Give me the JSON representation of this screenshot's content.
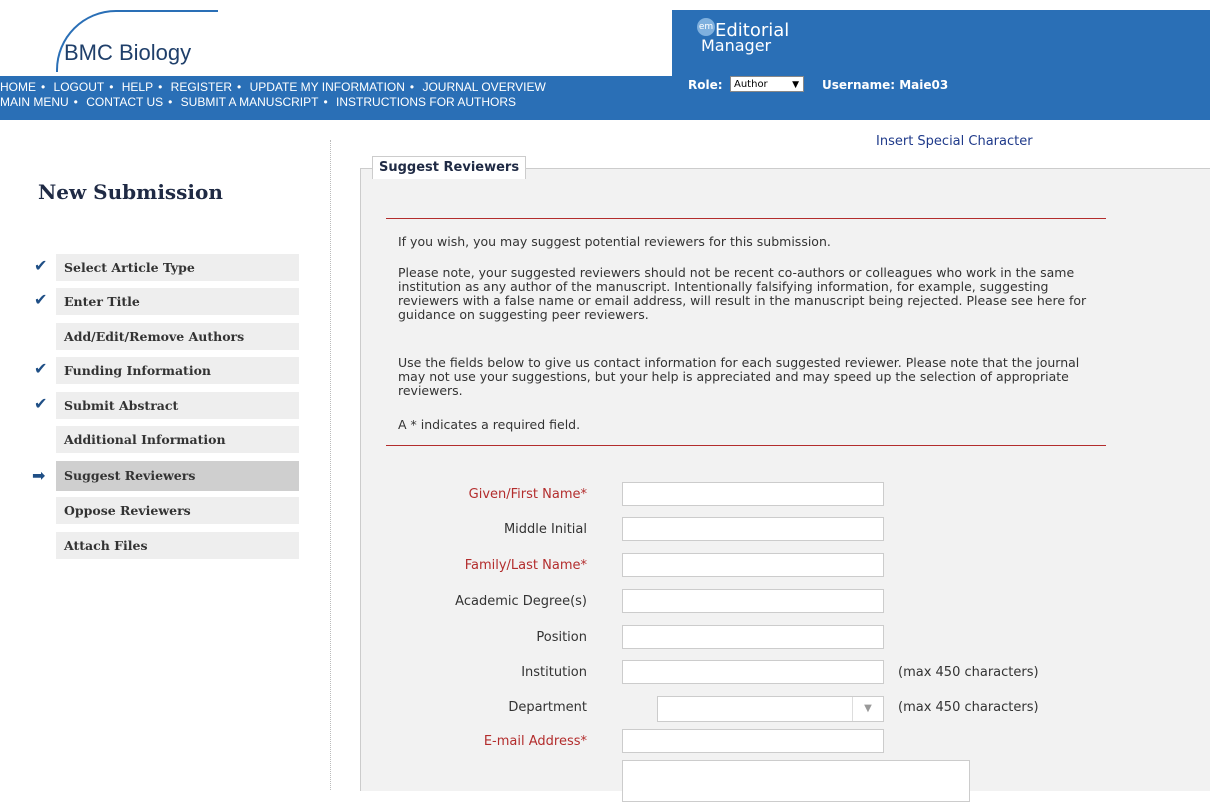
{
  "header": {
    "logo_text": "BMC Biology",
    "nav_row1": [
      "HOME",
      "LOGOUT",
      "HELP",
      "REGISTER",
      "UPDATE MY INFORMATION",
      "JOURNAL OVERVIEW"
    ],
    "nav_row2": [
      "MAIN MENU",
      "CONTACT US",
      "SUBMIT A MANUSCRIPT",
      "INSTRUCTIONS FOR AUTHORS"
    ],
    "em_badge": "em",
    "em_line1": "Editorial",
    "em_line2": "Manager",
    "role_label": "Role:",
    "role_value": "Author",
    "username_label": "Username: Maie03"
  },
  "sidebar": {
    "title": "New Submission",
    "steps": [
      {
        "label": "Select Article Type",
        "status": "done"
      },
      {
        "label": "Enter Title",
        "status": "done"
      },
      {
        "label": "Add/Edit/Remove Authors",
        "status": "none"
      },
      {
        "label": "Funding Information",
        "status": "done"
      },
      {
        "label": "Submit Abstract",
        "status": "done"
      },
      {
        "label": "Additional Information",
        "status": "none"
      },
      {
        "label": "Suggest Reviewers",
        "status": "current"
      },
      {
        "label": "Oppose Reviewers",
        "status": "none"
      },
      {
        "label": "Attach Files",
        "status": "none"
      }
    ]
  },
  "main": {
    "insert_special": "Insert Special Character",
    "panel_title": "Suggest Reviewers",
    "para1": "If you wish, you may suggest potential reviewers for this submission.",
    "para2": "Please note, your suggested reviewers should not be recent co-authors or colleagues who work in the same institution as any author of the manuscript. Intentionally falsifying information, for example, suggesting reviewers with a false name or email address, will result in the manuscript being rejected. Please see here for guidance on suggesting peer reviewers.",
    "para3": "Use the fields below to give us contact information for each suggested reviewer. Please note that the journal may not use your suggestions, but your help is appreciated and may speed up the selection of appropriate reviewers.",
    "para4": "A * indicates a required field.",
    "fields": {
      "given_name": "Given/First Name*",
      "middle_initial": "Middle Initial",
      "family_name": "Family/Last Name*",
      "academic_degree": "Academic Degree(s)",
      "position": "Position",
      "institution": "Institution",
      "department": "Department",
      "email": "E-mail Address*"
    },
    "hint_institution": "(max 450 characters)",
    "hint_department": "(max 450 characters)"
  },
  "colors": {
    "header_blue": "#2a6fb6",
    "required_red": "#b32d2d"
  }
}
